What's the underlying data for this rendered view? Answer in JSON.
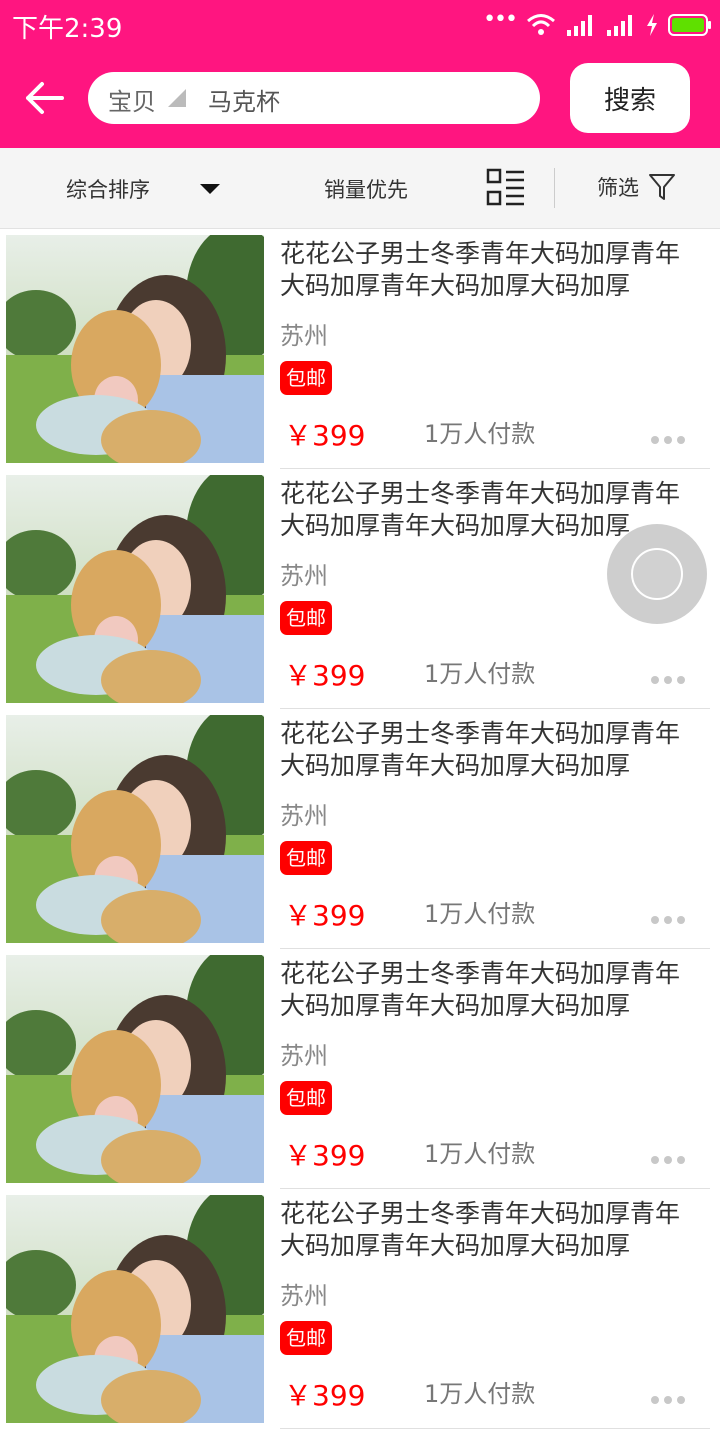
{
  "status_bar": {
    "time": "下午2:39",
    "dots": "•••"
  },
  "search": {
    "type_label": "宝贝",
    "value": "马克杯",
    "button_label": "搜索"
  },
  "sort_bar": {
    "default_label": "综合排序",
    "sales_label": "销量优先",
    "filter_label": "筛选"
  },
  "colors": {
    "brand": "#ff1580",
    "price": "#ff0000",
    "badge": "#ff0000"
  },
  "products": [
    {
      "title": "花花公子男士冬季青年大码加厚青年大码加厚青年大码加厚大码加厚",
      "location": "苏州",
      "badge": "包邮",
      "price": "￥399",
      "sales": "1万人付款"
    },
    {
      "title": "花花公子男士冬季青年大码加厚青年大码加厚青年大码加厚大码加厚",
      "location": "苏州",
      "badge": "包邮",
      "price": "￥399",
      "sales": "1万人付款"
    },
    {
      "title": "花花公子男士冬季青年大码加厚青年大码加厚青年大码加厚大码加厚",
      "location": "苏州",
      "badge": "包邮",
      "price": "￥399",
      "sales": "1万人付款"
    },
    {
      "title": "花花公子男士冬季青年大码加厚青年大码加厚青年大码加厚大码加厚",
      "location": "苏州",
      "badge": "包邮",
      "price": "￥399",
      "sales": "1万人付款"
    },
    {
      "title": "花花公子男士冬季青年大码加厚青年大码加厚青年大码加厚大码加厚",
      "location": "苏州",
      "badge": "包邮",
      "price": "￥399",
      "sales": "1万人付款"
    }
  ]
}
